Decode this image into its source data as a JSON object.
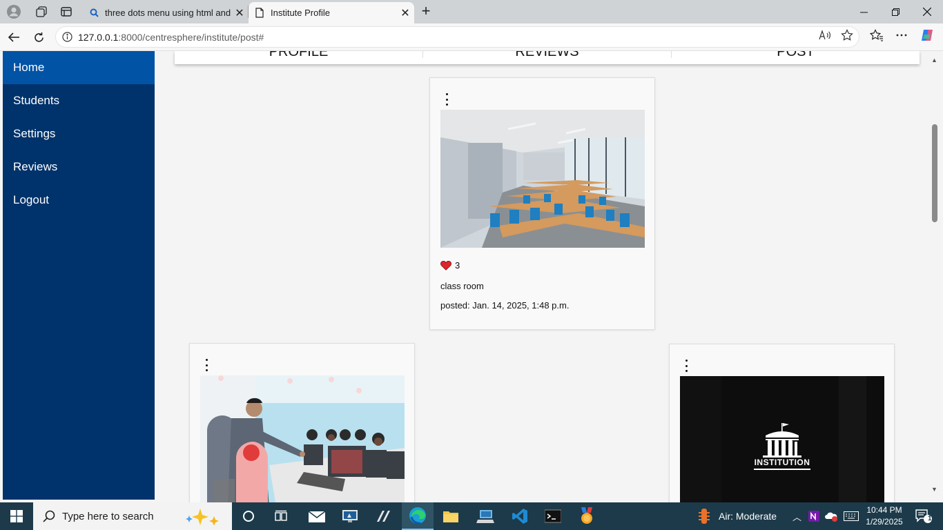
{
  "browser": {
    "tabs": [
      {
        "title": "three dots menu using html and c",
        "icon": "search-icon",
        "active": false
      },
      {
        "title": "Institute Profile",
        "icon": "page-icon",
        "active": true
      }
    ],
    "address": {
      "host": "127.0.0.1",
      "path": ":8000/centresphere/institute/post#"
    }
  },
  "sidebar": {
    "items": [
      {
        "label": "Home",
        "active": true
      },
      {
        "label": "Students"
      },
      {
        "label": "Settings"
      },
      {
        "label": "Reviews"
      },
      {
        "label": "Logout"
      }
    ]
  },
  "topnav": {
    "tabs": [
      "PROFILE",
      "REVIEWS",
      "POST"
    ]
  },
  "posts": [
    {
      "likes": "3",
      "caption": "class room",
      "posted": "posted: Jan. 14, 2025, 1:48 p.m.",
      "image": "classroom"
    },
    {
      "image": "computer-lab"
    },
    {
      "image": "institution-logo",
      "logo_text": "INSTITUTION"
    }
  ],
  "taskbar": {
    "search_placeholder": "Type here to search",
    "weather": "Air: Moderate",
    "time": "10:44 PM",
    "date": "1/29/2025",
    "notifications": "1"
  },
  "colors": {
    "sidebar": "#00336b",
    "sidebar_active": "#0153a5",
    "like": "#e0242b"
  }
}
